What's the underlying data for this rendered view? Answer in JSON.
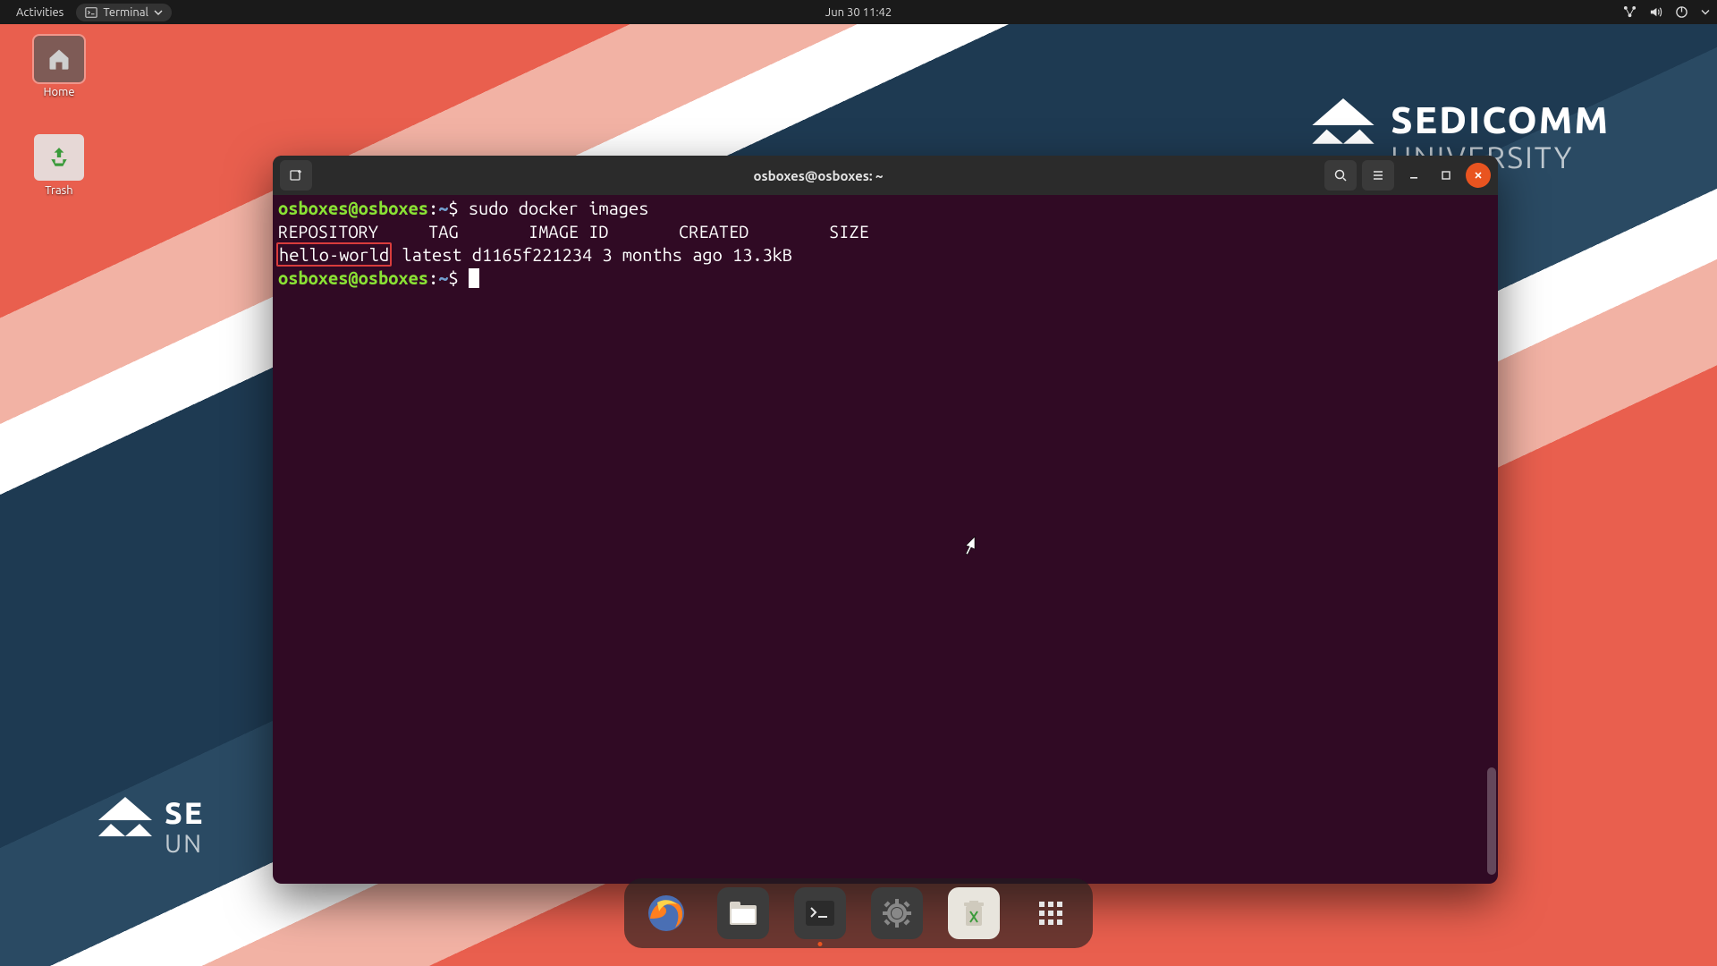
{
  "topbar": {
    "activities": "Activities",
    "app_label": "Terminal",
    "datetime": "Jun 30  11:42"
  },
  "desktop": {
    "home_label": "Home",
    "trash_label": "Trash"
  },
  "branding": {
    "line1": "SEDICOMM",
    "line2": "UNIVERSITY",
    "bl1": "SE",
    "bl2": "UN"
  },
  "terminal": {
    "title": "osboxes@osboxes: ~",
    "prompt_user": "osboxes@osboxes",
    "prompt_path": "~",
    "command": "sudo docker images",
    "headers": "REPOSITORY     TAG       IMAGE ID       CREATED        SIZE",
    "row_repo": "hello-world",
    "row_rest": "   latest    d1165f221234   3 months ago   13.3kB"
  },
  "dock": {
    "items": [
      "firefox",
      "files",
      "terminal",
      "settings",
      "trash",
      "apps"
    ]
  }
}
